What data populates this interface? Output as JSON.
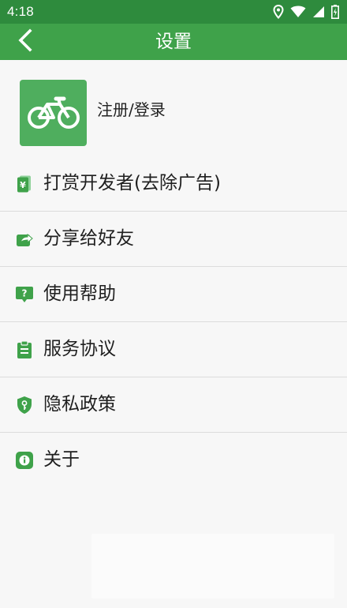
{
  "status_bar": {
    "time": "4:18",
    "icons": [
      "location-icon",
      "wifi-icon",
      "signal-icon",
      "battery-icon"
    ]
  },
  "app_bar": {
    "title": "设置",
    "back_icon": "chevron-left-icon"
  },
  "account": {
    "label": "注册/登录",
    "logo_icon": "bicycle-icon"
  },
  "menu": {
    "items": [
      {
        "label": "打赏开发者(去除广告)",
        "icon": "reward-icon"
      },
      {
        "label": "分享给好友",
        "icon": "share-icon"
      },
      {
        "label": "使用帮助",
        "icon": "help-icon"
      },
      {
        "label": "服务协议",
        "icon": "clipboard-icon"
      },
      {
        "label": "隐私政策",
        "icon": "privacy-shield-icon"
      },
      {
        "label": "关于",
        "icon": "info-icon"
      }
    ]
  },
  "colors": {
    "status_bar": "#2e8b3d",
    "app_bar": "#3fa24a",
    "accent": "#4fae5e",
    "background": "#f7f7f7",
    "divider": "#dcdcdc",
    "text": "#1f1f1f"
  }
}
